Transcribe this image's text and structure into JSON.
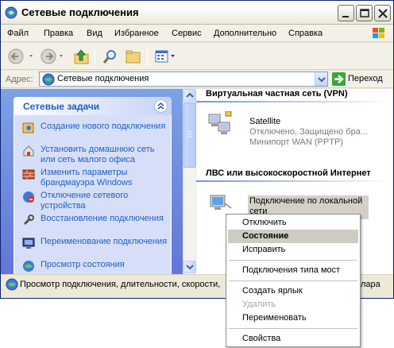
{
  "window": {
    "title": "Сетевые подключения"
  },
  "menu": [
    "Файл",
    "Правка",
    "Вид",
    "Избранное",
    "Сервис",
    "Дополнительно",
    "Справка"
  ],
  "toolbar": {
    "icons": [
      "back-icon",
      "forward-icon",
      "up-folder-icon",
      "search-icon",
      "folders-icon",
      "views-icon"
    ]
  },
  "address": {
    "label": "Адрес:",
    "value": "Сетевые подключения",
    "go_label": "Переход"
  },
  "tasks": {
    "header": "Сетевые задачи",
    "items": [
      {
        "label": "Создание нового подключения",
        "icon": "new-connection-icon"
      },
      {
        "label": "Установить домашнюю сеть или сеть малого офиса",
        "icon": "home-network-icon"
      },
      {
        "label": "Изменить параметры брандмауэра Windows",
        "icon": "firewall-icon"
      },
      {
        "label": "Отключение сетевого устройства",
        "icon": "disable-device-icon"
      },
      {
        "label": "Восстановление подключения",
        "icon": "repair-icon"
      },
      {
        "label": "Переименование подключения",
        "icon": "rename-icon"
      },
      {
        "label": "Просмотр состояния",
        "icon": "status-icon"
      }
    ]
  },
  "groups": {
    "vpn": {
      "title": "Виртуальная частная сеть (VPN)",
      "connection": {
        "name": "Satellite",
        "status": "Отключено, Защищено бра...",
        "device": "Минипорт WAN (PPTP)"
      }
    },
    "lan": {
      "title": "ЛВС или высокоскоростной Интернет",
      "connection": {
        "name_line1": "Подключение по локальной",
        "name_line2": "сети"
      }
    }
  },
  "status": {
    "text": "Просмотр подключения, длительности, скорости,",
    "overflow": "лара"
  },
  "context_menu": {
    "items": [
      {
        "label": "Отключить",
        "state": "normal"
      },
      {
        "label": "Состояние",
        "state": "selected"
      },
      {
        "label": "Исправить",
        "state": "normal"
      },
      {
        "label": "Подключения типа мост",
        "state": "normal"
      },
      {
        "label": "Создать ярлык",
        "state": "normal"
      },
      {
        "label": "Удалить",
        "state": "disabled"
      },
      {
        "label": "Переименовать",
        "state": "normal"
      },
      {
        "label": "Свойства",
        "state": "normal"
      }
    ]
  },
  "colors": {
    "task_link": "#215dc6",
    "left_pane": "#6375d6",
    "title_border": "#0a246a"
  }
}
